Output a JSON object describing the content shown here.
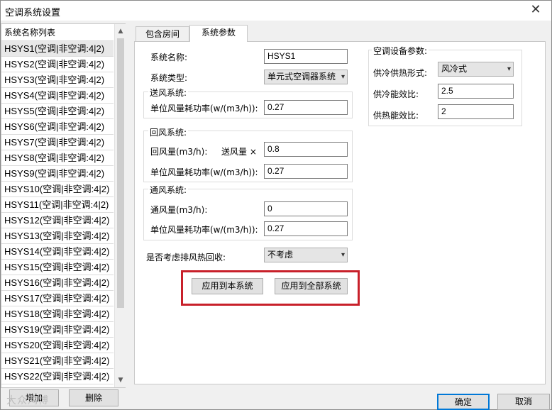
{
  "window": {
    "title": "空调系统设置",
    "close_glyph": "✕"
  },
  "list": {
    "header": "系统名称列表",
    "items": [
      "HSYS1(空调|非空调:4|2)",
      "HSYS2(空调|非空调:4|2)",
      "HSYS3(空调|非空调:4|2)",
      "HSYS4(空调|非空调:4|2)",
      "HSYS5(空调|非空调:4|2)",
      "HSYS6(空调|非空调:4|2)",
      "HSYS7(空调|非空调:4|2)",
      "HSYS8(空调|非空调:4|2)",
      "HSYS9(空调|非空调:4|2)",
      "HSYS10(空调|非空调:4|2)",
      "HSYS11(空调|非空调:4|2)",
      "HSYS12(空调|非空调:4|2)",
      "HSYS13(空调|非空调:4|2)",
      "HSYS14(空调|非空调:4|2)",
      "HSYS15(空调|非空调:4|2)",
      "HSYS16(空调|非空调:4|2)",
      "HSYS17(空调|非空调:4|2)",
      "HSYS18(空调|非空调:4|2)",
      "HSYS19(空调|非空调:4|2)",
      "HSYS20(空调|非空调:4|2)",
      "HSYS21(空调|非空调:4|2)",
      "HSYS22(空调|非空调:4|2)"
    ],
    "add_label": "增加",
    "delete_label": "删除",
    "watermark": "大众鸿博"
  },
  "tabs": [
    {
      "label": "包含房间"
    },
    {
      "label": "系统参数"
    }
  ],
  "form": {
    "system_name_label": "系统名称:",
    "system_name_value": "HSYS1",
    "system_type_label": "系统类型:",
    "system_type_value": "单元式空调器系统",
    "supply_group": "送风系统:",
    "supply_power_label": "单位风量耗功率(w/(m3/h)):",
    "supply_power_value": "0.27",
    "return_group": "回风系统:",
    "return_volume_label": "回风量(m3/h):",
    "return_volume_mid": "送风量 ×",
    "return_volume_value": "0.8",
    "return_power_label": "单位风量耗功率(w/(m3/h)):",
    "return_power_value": "0.27",
    "vent_group": "通风系统:",
    "vent_volume_label": "通风量(m3/h):",
    "vent_volume_value": "0",
    "vent_power_label": "单位风量耗功率(w/(m3/h)):",
    "vent_power_value": "0.27",
    "heat_recovery_label": "是否考虑排风热回收:",
    "heat_recovery_value": "不考虑"
  },
  "equipment": {
    "group": "空调设备参数:",
    "mode_label": "供冷供热形式:",
    "mode_value": "风冷式",
    "cooling_label": "供冷能效比:",
    "cooling_value": "2.5",
    "heating_label": "供热能效比:",
    "heating_value": "2"
  },
  "actions": {
    "apply_this": "应用到本系统",
    "apply_all": "应用到全部系统",
    "ok": "确定",
    "cancel": "取消"
  },
  "colors": {
    "highlight": "#c8202a",
    "accent": "#0078d7"
  }
}
